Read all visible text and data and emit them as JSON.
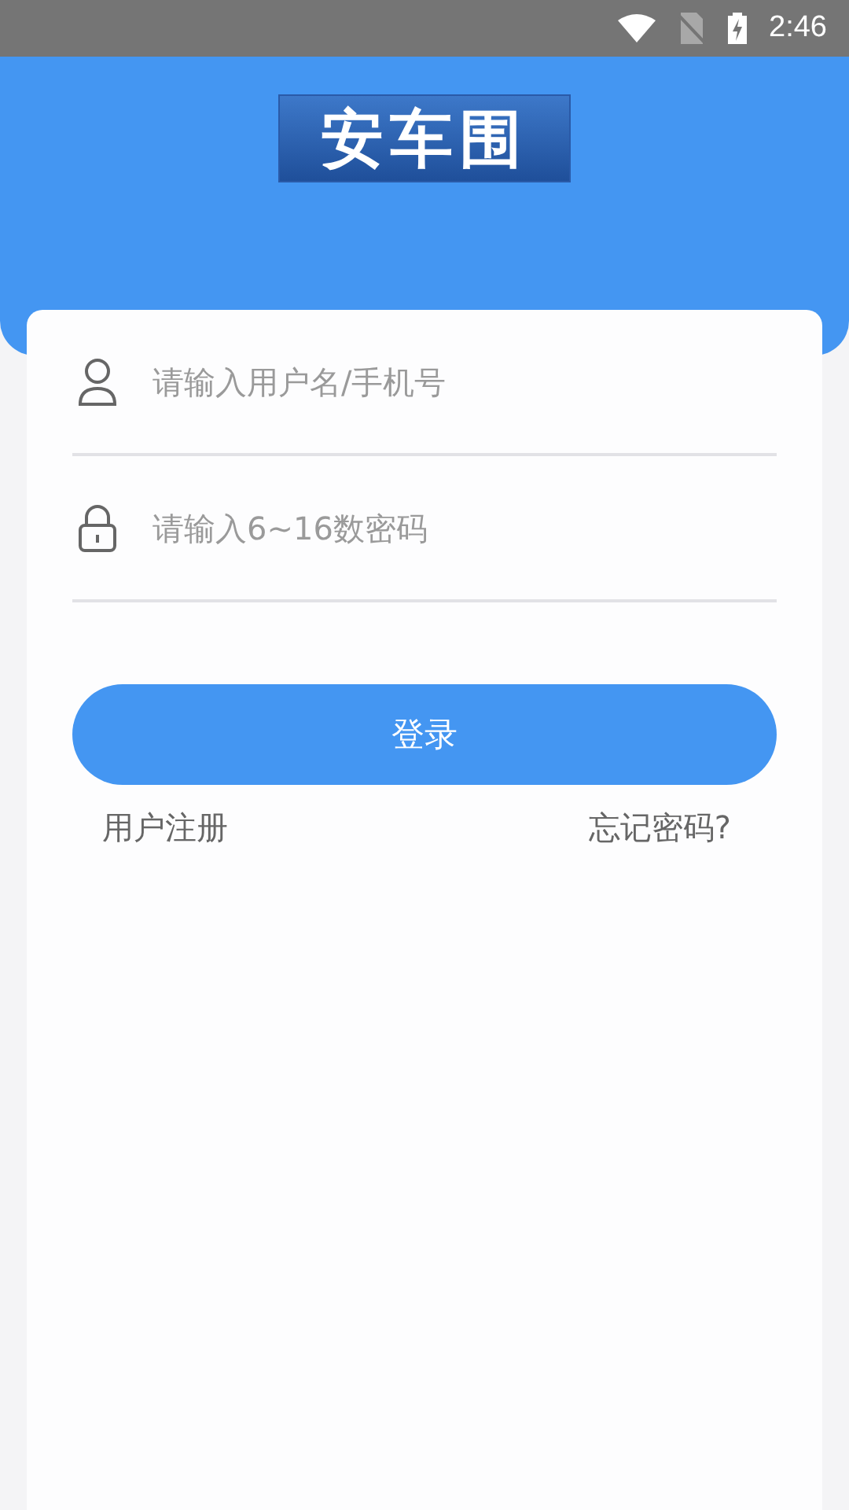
{
  "status_bar": {
    "time": "2:46"
  },
  "header": {
    "logo": "安车围"
  },
  "fields": [
    {
      "kind": "user",
      "placeholder": "请输入用户名/手机号"
    },
    {
      "kind": "password",
      "placeholder": "请输入6~16数密码"
    }
  ],
  "login_button": "登录",
  "links": [
    "用户注册",
    "忘记密码?"
  ]
}
